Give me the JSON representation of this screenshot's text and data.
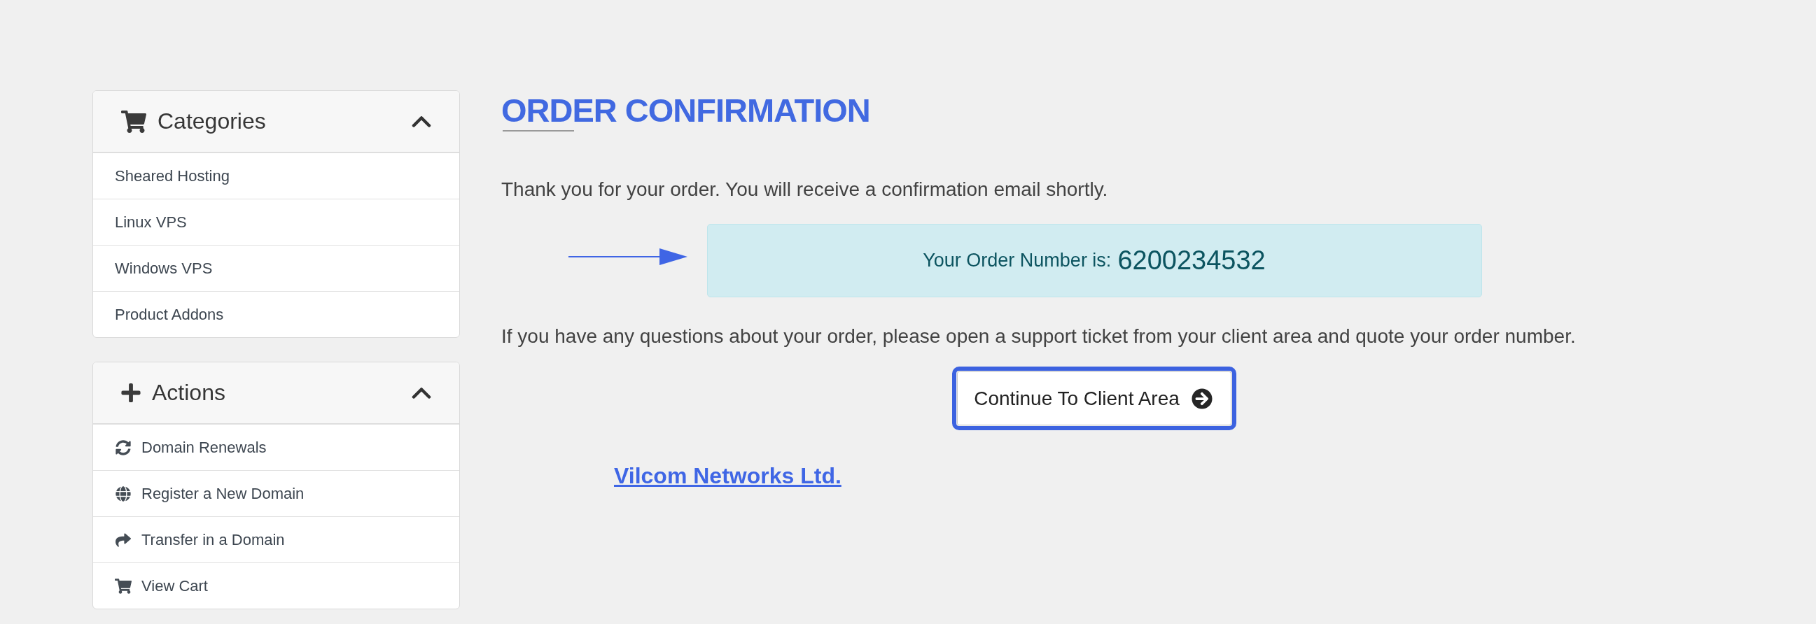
{
  "sidebar": {
    "panels": [
      {
        "title": "Categories",
        "expanded": true,
        "items": [
          "Sheared Hosting",
          "Linux VPS",
          "Windows VPS",
          "Product Addons"
        ]
      },
      {
        "title": "Actions",
        "expanded": true,
        "items": [
          "Domain Renewals",
          "Register a New Domain",
          "Transfer in a Domain",
          "View Cart"
        ]
      }
    ]
  },
  "main": {
    "title": "ORDER CONFIRMATION",
    "message": "Thank you for your order. You will receive a confirmation email shortly.",
    "order_number": {
      "label": "Your Order Number is:",
      "value": "6200234532"
    },
    "support_note": "If you have any questions about your order, please open a support ticket from your client area and quote your order number.",
    "continue_button": {
      "label": "Continue To Client Area",
      "highlighted": true
    },
    "company_link": "Vilcom Networks Ltd."
  }
}
